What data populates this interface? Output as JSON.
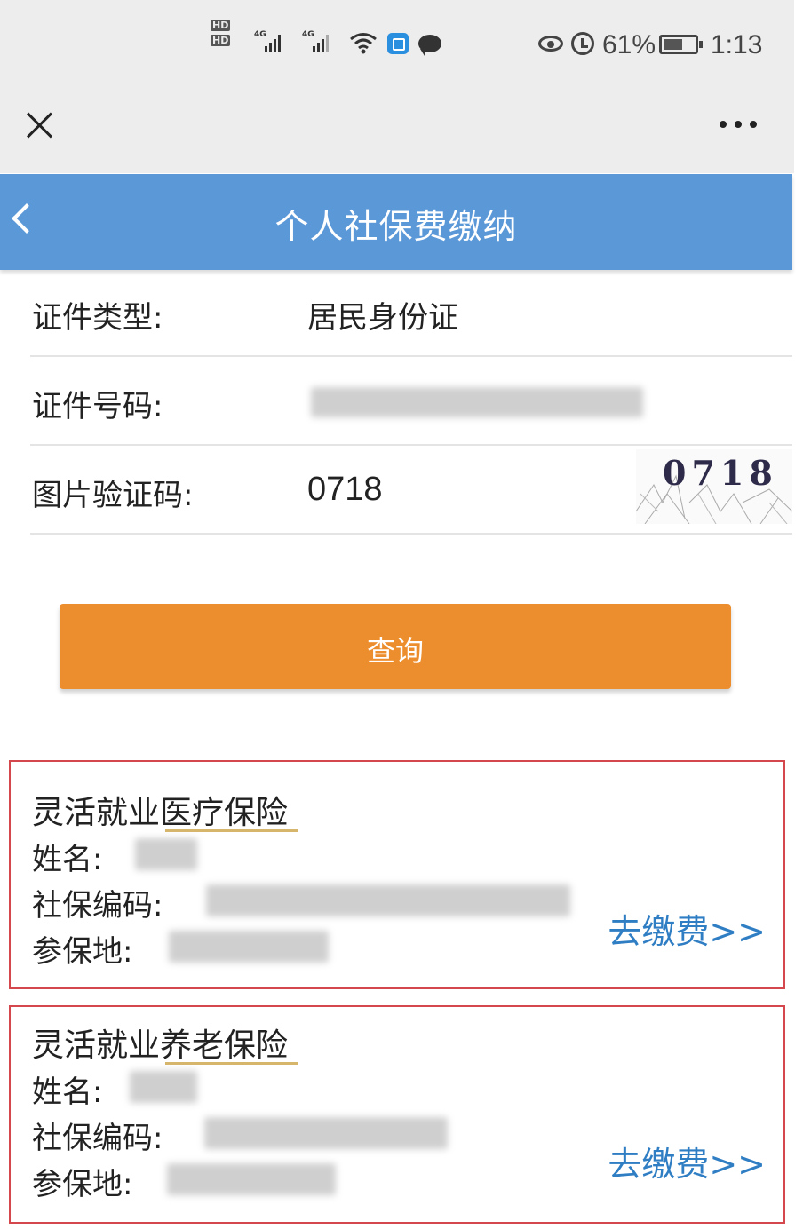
{
  "status_bar": {
    "hd1": "HD",
    "hd2": "HD",
    "net1": "4G",
    "net2": "4G",
    "battery_pct": "61%",
    "battery_level": 0.61,
    "time": "1:13",
    "icons": [
      "wifi-icon",
      "app-notification-icon",
      "chat-icon",
      "eye-icon",
      "alarm-icon",
      "battery-icon"
    ]
  },
  "top_bar": {
    "icons": [
      "close-icon",
      "more-icon"
    ]
  },
  "header": {
    "title": "个人社保费缴纳",
    "back_icon": "chevron-left-icon"
  },
  "form": {
    "id_type_label": "证件类型:",
    "id_type_value": "居民身份证",
    "id_number_label": "证件号码:",
    "captcha_label": "图片验证码:",
    "captcha_value": "0718",
    "captcha_image_text": "0718"
  },
  "query_button": "查询",
  "cards": [
    {
      "title": "灵活就业医疗保险",
      "name_label": "姓名:",
      "code_label": "社保编码:",
      "place_label": "参保地:",
      "pay_link": "去缴费>>"
    },
    {
      "title": "灵活就业养老保险",
      "name_label": "姓名:",
      "code_label": "社保编码:",
      "place_label": "参保地:",
      "pay_link": "去缴费>>"
    }
  ],
  "colors": {
    "header_blue": "#5b98d8",
    "button_orange": "#ed8e2e",
    "card_border_red": "#d4474c",
    "link_blue": "#2f7ec4"
  }
}
